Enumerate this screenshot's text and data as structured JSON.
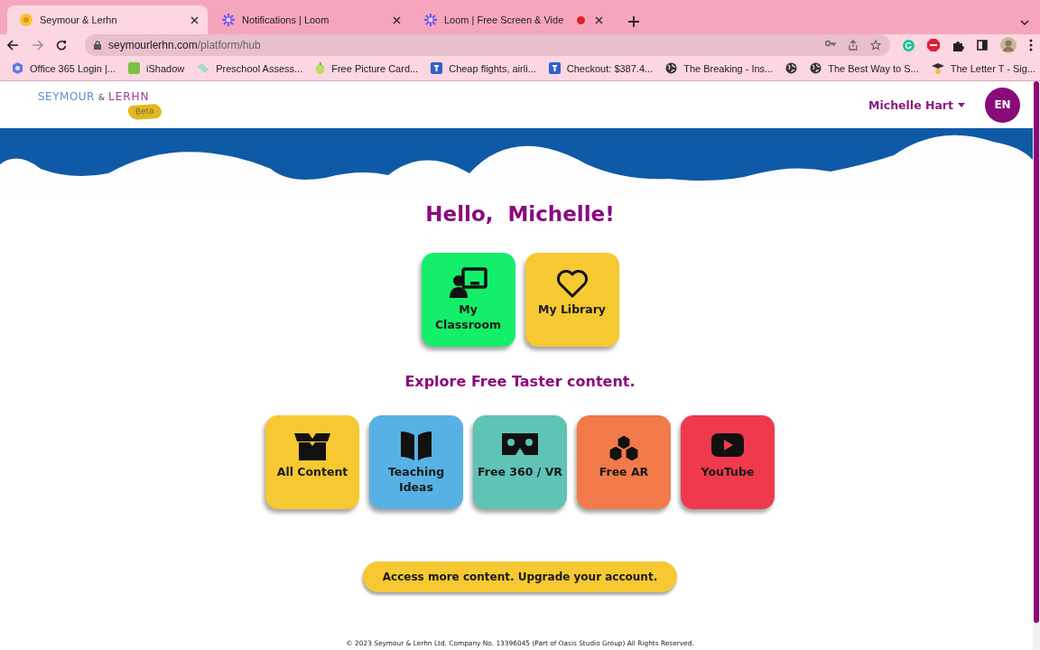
{
  "browser": {
    "tabs": [
      {
        "title": "Seymour & Lerhn",
        "selected": true,
        "recording": false
      },
      {
        "title": "Notifications | Loom",
        "selected": false,
        "recording": false
      },
      {
        "title": "Loom | Free Screen & Vide",
        "selected": false,
        "recording": true
      }
    ],
    "url_host": "seymourlerhn.com",
    "url_path": "/platform/hub",
    "bookmarks": [
      {
        "kind": "labeled",
        "title": "Office 365 Login |..."
      },
      {
        "kind": "labeled",
        "title": "iShadow"
      },
      {
        "kind": "labeled",
        "title": "Preschool Assess..."
      },
      {
        "kind": "labeled",
        "title": "Free Picture Card..."
      },
      {
        "kind": "labeled",
        "title": "Cheap flights, airli..."
      },
      {
        "kind": "labeled",
        "title": "Checkout: $387.4..."
      },
      {
        "kind": "labeled",
        "title": "The Breaking - Ins..."
      },
      {
        "kind": "icon"
      },
      {
        "kind": "labeled",
        "title": "The Best Way to S..."
      },
      {
        "kind": "labeled",
        "title": "The Letter T - Sig..."
      }
    ]
  },
  "header": {
    "logo": {
      "name_left": "SEYMOUR",
      "amp": "&",
      "name_right": "LERHN",
      "badge": "Beta"
    },
    "user": "Michelle Hart",
    "language": "EN"
  },
  "greeting": "Hello,  Michelle!",
  "main_tiles": [
    {
      "label": "My Classroom",
      "color": "#14ee6a"
    },
    {
      "label": "My Library",
      "color": "#f6c832"
    }
  ],
  "explore_heading": "Explore Free Taster content.",
  "taster_tiles": [
    {
      "label": "All Content",
      "color": "#f6c832"
    },
    {
      "label": "Teaching Ideas",
      "color": "#58b1e4"
    },
    {
      "label": "Free 360 / VR",
      "color": "#5fc3b5"
    },
    {
      "label": "Free AR",
      "color": "#f27a4a"
    },
    {
      "label": "YouTube",
      "color": "#ef3a4d"
    }
  ],
  "upgrade_button": "Access more content. Upgrade your account.",
  "footer": "© 2023 Seymour & Lerhn Ltd. Company No. 13396045 (Part of Oasis Studio Group) All Rights Reserved."
}
